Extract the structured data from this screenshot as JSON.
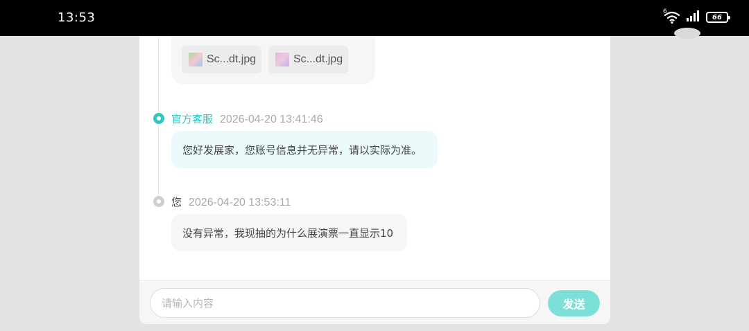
{
  "status_bar": {
    "time": "13:53",
    "wifi_badge": "6",
    "battery_level": "66"
  },
  "conversation": {
    "attachments": [
      {
        "name": "Sc...dt.jpg",
        "thumb_icon": "image-thumbnail-icon"
      },
      {
        "name": "Sc...dt.jpg",
        "thumb_icon": "image-thumbnail-icon"
      }
    ],
    "messages": [
      {
        "sender": "官方客服",
        "timestamp": "2026-04-20 13:41:46",
        "text": "您好发展家，您账号信息并无异常，请以实际为准。"
      },
      {
        "sender": "您",
        "timestamp": "2026-04-20 13:53:11",
        "text": "没有异常，我现抽的为什么展演票一直显示10"
      }
    ]
  },
  "composer": {
    "placeholder": "请输入内容",
    "value": "",
    "send_label": "发送"
  },
  "colors": {
    "accent": "#2dc8c0",
    "send_button": "#7de0d8",
    "agent_bubble": "#eafafa",
    "user_bubble": "#f6f6f6"
  }
}
